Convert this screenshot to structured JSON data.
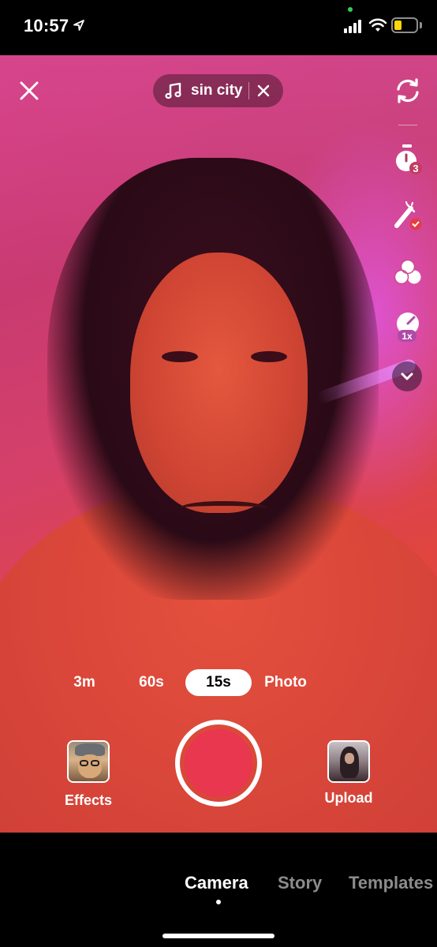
{
  "status_bar": {
    "time": "10:57",
    "battery_level_percent": 30,
    "battery_color": "#ffd60a",
    "privacy_dot_color": "#31d158"
  },
  "camera": {
    "sound": {
      "name": "sin city",
      "icon": "music-note-icon"
    },
    "close_icon": "close-icon",
    "side_tools": [
      {
        "name": "flip-camera",
        "icon": "flip-camera-icon"
      },
      {
        "name": "timer",
        "icon": "timer-icon",
        "badge": "3"
      },
      {
        "name": "beautify",
        "icon": "magic-wand-icon"
      },
      {
        "name": "filters",
        "icon": "filters-icon"
      },
      {
        "name": "speed",
        "icon": "speed-icon",
        "badge": "1x"
      },
      {
        "name": "more",
        "icon": "chevron-down-icon"
      }
    ],
    "modes": [
      "3m",
      "60s",
      "15s",
      "Photo"
    ],
    "active_mode": "15s",
    "effects_label": "Effects",
    "upload_label": "Upload",
    "record_color": "#e8374f"
  },
  "bottom_tabs": {
    "items": [
      "Camera",
      "Story",
      "Templates"
    ],
    "active": "Camera"
  }
}
